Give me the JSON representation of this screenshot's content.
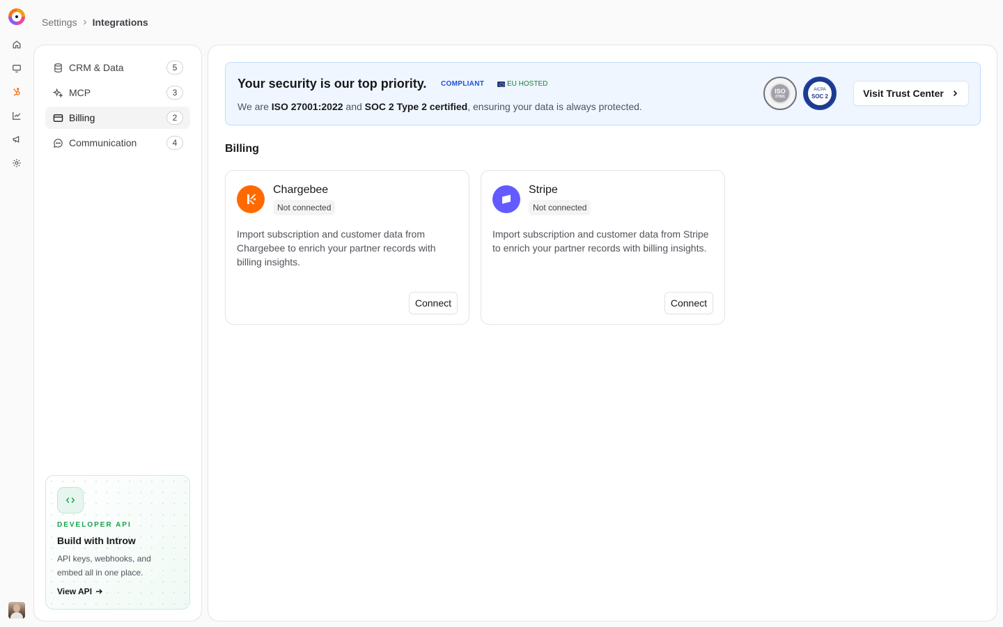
{
  "breadcrumb": {
    "parent": "Settings",
    "current": "Integrations"
  },
  "rail": {
    "icons": [
      "home-icon",
      "monitor-icon",
      "hubspot-icon",
      "chart-icon",
      "megaphone-icon",
      "gear-icon"
    ]
  },
  "sidebar": {
    "items": [
      {
        "label": "CRM & Data",
        "count": "5",
        "icon": "database-icon"
      },
      {
        "label": "MCP",
        "count": "3",
        "icon": "sparkles-icon"
      },
      {
        "label": "Billing",
        "count": "2",
        "icon": "credit-card-icon",
        "active": true
      },
      {
        "label": "Communication",
        "count": "4",
        "icon": "message-icon"
      }
    ],
    "dev_card": {
      "kicker": "DEVELOPER API",
      "title": "Build with Introw",
      "desc": "API keys, webhooks, and embed all in one place.",
      "link": "View API"
    }
  },
  "banner": {
    "title": "Your security is our top priority.",
    "badge_compliant": "COMPLIANT",
    "badge_eu": "EU HOSTED",
    "desc_pre": "We are ",
    "desc_iso": "ISO 27001:2022",
    "desc_mid": " and ",
    "desc_soc": "SOC 2 Type 2 certified",
    "desc_post": ", ensuring your data is always protected.",
    "trust_button": "Visit Trust Center",
    "seal_iso": "ISO",
    "seal_iso_sub": "27001",
    "seal_soc_top": "AICPA",
    "seal_soc": "SOC 2"
  },
  "main": {
    "section_title": "Billing",
    "cards": [
      {
        "name": "Chargebee",
        "status": "Not connected",
        "desc": "Import subscription and customer data from Chargebee to enrich your partner records with billing insights.",
        "button": "Connect",
        "color": "#ff6a00"
      },
      {
        "name": "Stripe",
        "status": "Not connected",
        "desc": "Import subscription and customer data from Stripe to enrich your partner records with billing insights.",
        "button": "Connect",
        "color": "#635bff"
      }
    ]
  },
  "colors": {
    "accent_green": "#16a34a",
    "banner_bg": "#eff6ff",
    "compliant_blue": "#1d4ed8"
  }
}
